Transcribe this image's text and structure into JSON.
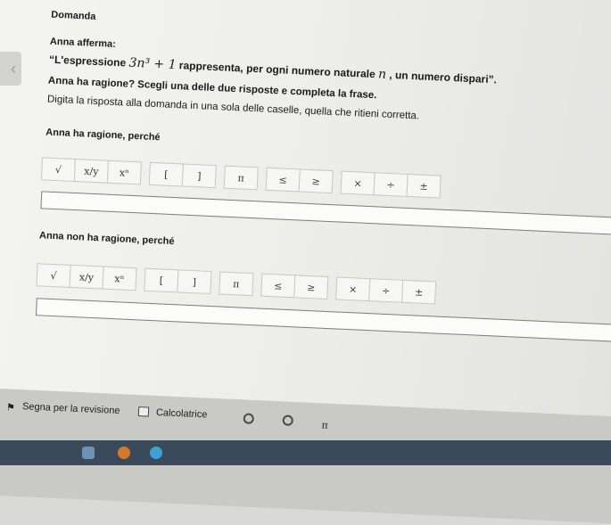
{
  "question": {
    "title": "Domanda",
    "claim_intro": "Anna afferma:",
    "claim_open": "“L'espressione ",
    "claim_math": "3n³ + 1",
    "claim_mid": " rappresenta, per ogni numero naturale ",
    "claim_var": "n",
    "claim_close": " , un numero dispari”.",
    "prompt": "Anna ha ragione? Scegli una delle due risposte e completa la frase.",
    "instruction": "Digita la risposta alla domanda in una sola delle caselle, quella che ritieni corretta."
  },
  "option1": {
    "label": "Anna ha ragione, perché"
  },
  "option2": {
    "label": "Anna non ha ragione, perché"
  },
  "keys": {
    "sqrt": "√",
    "frac": "x/y",
    "pow": "xⁿ",
    "lbr": "[",
    "rbr": "]",
    "pi": "π",
    "le": "≤",
    "ge": "≥",
    "times": "×",
    "div": "÷",
    "pm": "±"
  },
  "footer": {
    "review": "Segna per la revisione",
    "calculator": "Calcolatrice",
    "pi_mark": "π"
  },
  "icons": {
    "back": "chevron-left-icon",
    "flag": "flag-icon",
    "calculator": "calculator-icon"
  }
}
